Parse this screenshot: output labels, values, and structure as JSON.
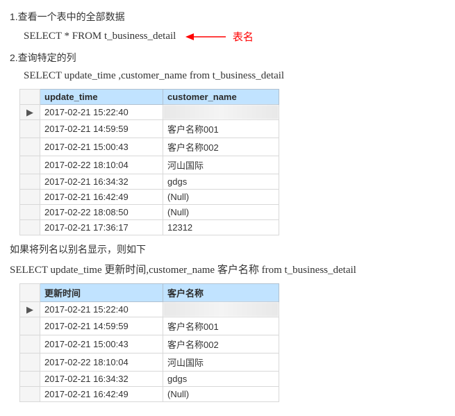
{
  "section1_title": "1.查看一个表中的全部数据",
  "sql1": "SELECT * FROM t_business_detail",
  "arrow_label": "表名",
  "section2_title": "2.查询特定的列",
  "sql2": "SELECT update_time ,customer_name    from t_business_detail",
  "table1": {
    "headers": [
      "update_time",
      "customer_name"
    ],
    "rows": [
      {
        "c1": "2017-02-21 15:22:40",
        "c2": "",
        "blur": true,
        "ptr": true
      },
      {
        "c1": "2017-02-21 14:59:59",
        "c2": "客户名称001"
      },
      {
        "c1": "2017-02-21 15:00:43",
        "c2": "客户名称002"
      },
      {
        "c1": "2017-02-22 18:10:04",
        "c2": "河山国际"
      },
      {
        "c1": "2017-02-21 16:34:32",
        "c2": "gdgs"
      },
      {
        "c1": "2017-02-21 16:42:49",
        "c2": "(Null)",
        "null": true
      },
      {
        "c1": "2017-02-22 18:08:50",
        "c2": "(Null)",
        "null": true
      },
      {
        "c1": "2017-02-21 17:36:17",
        "c2": "12312"
      }
    ]
  },
  "alias_note": "如果将列名以别名显示，则如下",
  "sql3": "SELECT update_time  更新时间,customer_name  客户名称   from t_business_detail",
  "table2": {
    "headers": [
      "更新时间",
      "客户名称"
    ],
    "rows": [
      {
        "c1": "2017-02-21 15:22:40",
        "c2": "",
        "blur": true,
        "ptr": true
      },
      {
        "c1": "2017-02-21 14:59:59",
        "c2": "客户名称001"
      },
      {
        "c1": "2017-02-21 15:00:43",
        "c2": "客户名称002"
      },
      {
        "c1": "2017-02-22 18:10:04",
        "c2": "河山国际"
      },
      {
        "c1": "2017-02-21 16:34:32",
        "c2": "gdgs"
      },
      {
        "c1": "2017-02-21 16:42:49",
        "c2": "(Null)",
        "null": true
      }
    ]
  }
}
